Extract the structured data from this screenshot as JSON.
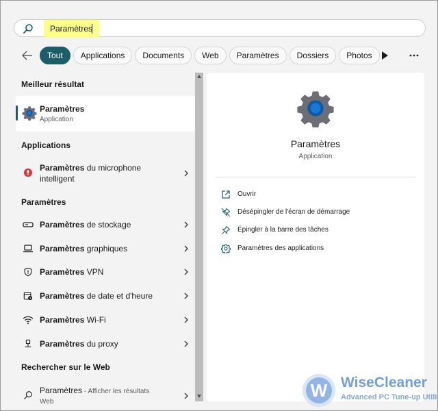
{
  "search": {
    "value": "Paramètres",
    "highlight_color": "#fbff88"
  },
  "filters": [
    {
      "label": "Tout",
      "active": true
    },
    {
      "label": "Applications",
      "active": false
    },
    {
      "label": "Documents",
      "active": false
    },
    {
      "label": "Web",
      "active": false
    },
    {
      "label": "Paramètres",
      "active": false
    },
    {
      "label": "Dossiers",
      "active": false
    },
    {
      "label": "Photos",
      "active": false
    }
  ],
  "accent_color": "#1b5e6a",
  "sections": {
    "best": "Meilleur résultat",
    "apps": "Applications",
    "settings": "Paramètres",
    "web": "Rechercher sur le Web"
  },
  "best_result": {
    "title": "Paramètres",
    "subtitle": "Application",
    "icon": "gear-icon"
  },
  "app_results": [
    {
      "bold": "Paramètres",
      "rest": " du microphone intelligent",
      "icon": "microphone-app-icon"
    }
  ],
  "settings_results": [
    {
      "bold": "Paramètres",
      "rest": " de stockage",
      "icon": "storage-icon"
    },
    {
      "bold": "Paramètres",
      "rest": " graphiques",
      "icon": "laptop-icon"
    },
    {
      "bold": "Paramètres",
      "rest": " VPN",
      "icon": "shield-icon"
    },
    {
      "bold": "Paramètres",
      "rest": " de date et d'heure",
      "icon": "calendar-clock-icon"
    },
    {
      "bold": "Paramètres",
      "rest": " Wi-Fi",
      "icon": "wifi-icon"
    },
    {
      "bold": "Paramètres",
      "rest": " du proxy",
      "icon": "proxy-icon"
    }
  ],
  "web_result": {
    "title": "Paramètres",
    "suffix": " - Afficher les résultats",
    "sub": "Web"
  },
  "detail": {
    "title": "Paramètres",
    "subtitle": "Application",
    "actions": [
      {
        "label": "Ouvrir",
        "icon": "open-icon"
      },
      {
        "label": "Désépingler de l'écran de démarrage",
        "icon": "unpin-icon"
      },
      {
        "label": "Épingler à la barre des tâches",
        "icon": "pin-icon"
      },
      {
        "label": "Paramètres des applications",
        "icon": "gear-icon"
      }
    ]
  },
  "watermark": {
    "name": "WiseCleaner",
    "tagline": "Advanced PC Tune-up Utilities"
  }
}
